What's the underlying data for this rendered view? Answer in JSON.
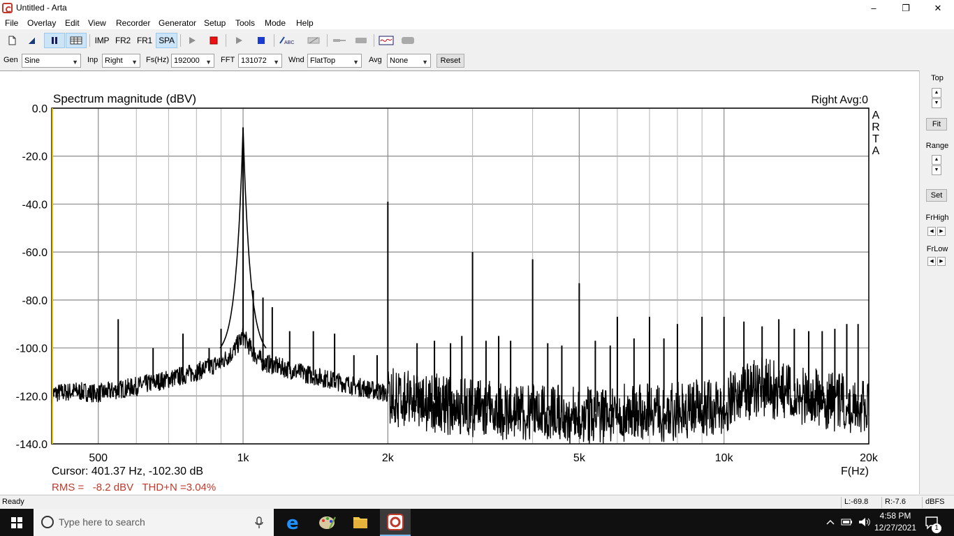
{
  "window": {
    "title": "Untitled - Arta",
    "minimize": "–",
    "maximize": "❐",
    "close": "✕"
  },
  "menu": [
    "File",
    "Overlay",
    "Edit",
    "View",
    "Recorder",
    "Generator",
    "Setup",
    "Tools",
    "Mode",
    "Help"
  ],
  "toolbar": {
    "imp": "IMP",
    "fr2": "FR2",
    "fr1": "FR1",
    "spa": "SPA",
    "abc": "ABC"
  },
  "controls": {
    "gen_label": "Gen",
    "gen_value": "Sine",
    "inp_label": "Inp",
    "inp_value": "Right",
    "fs_label": "Fs(Hz)",
    "fs_value": "192000",
    "fft_label": "FFT",
    "fft_value": "131072",
    "wnd_label": "Wnd",
    "wnd_value": "FlatTop",
    "avg_label": "Avg",
    "avg_value": "None",
    "reset": "Reset"
  },
  "side": {
    "top": "Top",
    "fit": "Fit",
    "range": "Range",
    "set": "Set",
    "frhigh": "FrHigh",
    "frlow": "FrLow"
  },
  "plot": {
    "title": "Spectrum magnitude (dBV)",
    "channel": "Right  Avg:0",
    "watermark": [
      "A",
      "R",
      "T",
      "A"
    ],
    "x_axis_label": "F(Hz)",
    "cursor": "Cursor: 401.37 Hz, -102.30 dB",
    "rms": "RMS =   -8.2 dBV   THD+N =3.04%",
    "trace_color": "#000000",
    "cursor_line_color": "#e0c000",
    "text_red": "#c0392b"
  },
  "chart_data": {
    "type": "line",
    "title": "Spectrum magnitude (dBV)",
    "xlabel": "F(Hz)",
    "ylabel": "",
    "x_scale": "log",
    "xlim": [
      400,
      20000
    ],
    "ylim": [
      -140,
      0
    ],
    "x_ticks": [
      {
        "value": 500,
        "label": "500"
      },
      {
        "value": 1000,
        "label": "1k"
      },
      {
        "value": 2000,
        "label": "2k"
      },
      {
        "value": 5000,
        "label": "5k"
      },
      {
        "value": 10000,
        "label": "10k"
      },
      {
        "value": 20000,
        "label": "20k"
      }
    ],
    "y_ticks": [
      {
        "value": 0,
        "label": "0.0"
      },
      {
        "value": -20,
        "label": "-20.0"
      },
      {
        "value": -40,
        "label": "-40.0"
      },
      {
        "value": -60,
        "label": "-60.0"
      },
      {
        "value": -80,
        "label": "-80.0"
      },
      {
        "value": -100,
        "label": "-100.0"
      },
      {
        "value": -120,
        "label": "-120.0"
      },
      {
        "value": -140,
        "label": "-140.0"
      }
    ],
    "grid": true,
    "minor_x_grid": [
      600,
      700,
      800,
      900,
      3000,
      4000,
      6000,
      7000,
      8000,
      9000
    ],
    "cursor_x": 401.37,
    "noise_floor": [
      [
        400,
        -119
      ],
      [
        450,
        -118
      ],
      [
        500,
        -119
      ],
      [
        600,
        -116
      ],
      [
        700,
        -113
      ],
      [
        800,
        -110
      ],
      [
        900,
        -106
      ],
      [
        950,
        -102
      ],
      [
        1000,
        -95
      ],
      [
        1050,
        -102
      ],
      [
        1100,
        -106
      ],
      [
        1300,
        -110
      ],
      [
        1500,
        -113
      ],
      [
        1800,
        -117
      ],
      [
        2000,
        -119
      ],
      [
        3000,
        -124
      ],
      [
        5000,
        -127
      ],
      [
        8000,
        -125
      ],
      [
        10000,
        -122
      ],
      [
        11000,
        -117
      ],
      [
        12000,
        -115
      ],
      [
        14000,
        -118
      ],
      [
        17000,
        -121
      ],
      [
        20000,
        -122
      ]
    ],
    "peaks": [
      [
        1000,
        -8
      ],
      [
        2000,
        -39
      ],
      [
        3000,
        -60
      ],
      [
        4000,
        -63
      ],
      [
        5000,
        -73
      ],
      [
        6000,
        -87
      ],
      [
        7000,
        -87
      ],
      [
        8000,
        -90
      ],
      [
        9000,
        -87
      ],
      [
        10000,
        -87
      ],
      [
        11000,
        -89
      ],
      [
        12000,
        -91
      ],
      [
        13000,
        -88
      ],
      [
        14000,
        -92
      ],
      [
        15000,
        -93
      ],
      [
        16000,
        -93
      ],
      [
        17000,
        -92
      ],
      [
        18000,
        -90
      ],
      [
        19000,
        -90
      ],
      [
        550,
        -88
      ],
      [
        650,
        -100
      ],
      [
        750,
        -94
      ],
      [
        850,
        -100
      ],
      [
        900,
        -92
      ],
      [
        1050,
        -76
      ],
      [
        1100,
        -79
      ],
      [
        1150,
        -83
      ],
      [
        1250,
        -93
      ],
      [
        1400,
        -93
      ],
      [
        1550,
        -94
      ],
      [
        1700,
        -103
      ],
      [
        1900,
        -103
      ],
      [
        2300,
        -98
      ],
      [
        2500,
        -97
      ],
      [
        2700,
        -98
      ],
      [
        2850,
        -95
      ],
      [
        3200,
        -97
      ],
      [
        3400,
        -95
      ],
      [
        3600,
        -97
      ],
      [
        4300,
        -98
      ],
      [
        4600,
        -99
      ],
      [
        5400,
        -97
      ],
      [
        5800,
        -99
      ],
      [
        6500,
        -96
      ],
      [
        7500,
        -96
      ]
    ]
  },
  "status": {
    "ready": "Ready",
    "left": "L:-69.8",
    "right": "R:-7.6",
    "unit": "dBFS"
  },
  "taskbar": {
    "search_placeholder": "Type here to search",
    "time": "4:58 PM",
    "date": "12/27/2021",
    "badge": "1"
  }
}
